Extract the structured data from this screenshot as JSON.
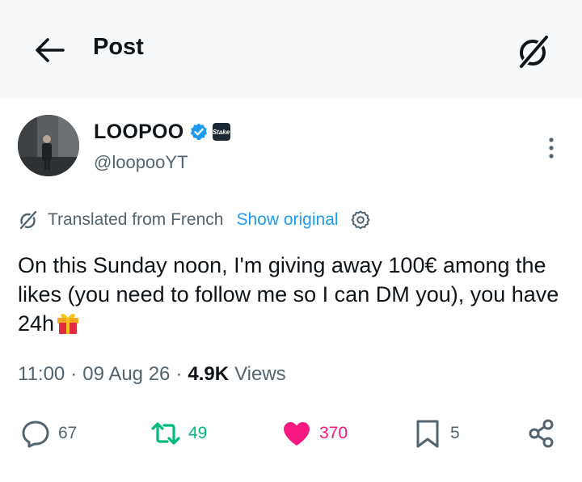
{
  "header": {
    "title": "Post",
    "back_icon": "arrow-left-icon",
    "grok_icon": "grok-icon"
  },
  "author": {
    "display_name": "LOOPOO",
    "handle": "@loopooYT",
    "verified_color": "#1d9bf0",
    "affiliate_badge": "Stake"
  },
  "translation": {
    "label": "Translated from French",
    "show_original": "Show original"
  },
  "tweet": {
    "text": "On this Sunday noon, I'm giving away 100€ among the likes (you need to follow me so I can DM you), you have 24h"
  },
  "meta": {
    "time": "11:00",
    "date": "09 Aug 26",
    "views_count": "4.9K",
    "views_label": "Views",
    "separator": "·"
  },
  "actions": {
    "replies": "67",
    "reposts": "49",
    "likes": "370",
    "bookmarks": "5"
  },
  "colors": {
    "accent": "#1d9bf0",
    "like": "#f91880",
    "repost": "#00ba7c",
    "muted": "#536471",
    "header_bg": "#f7f8f9"
  }
}
